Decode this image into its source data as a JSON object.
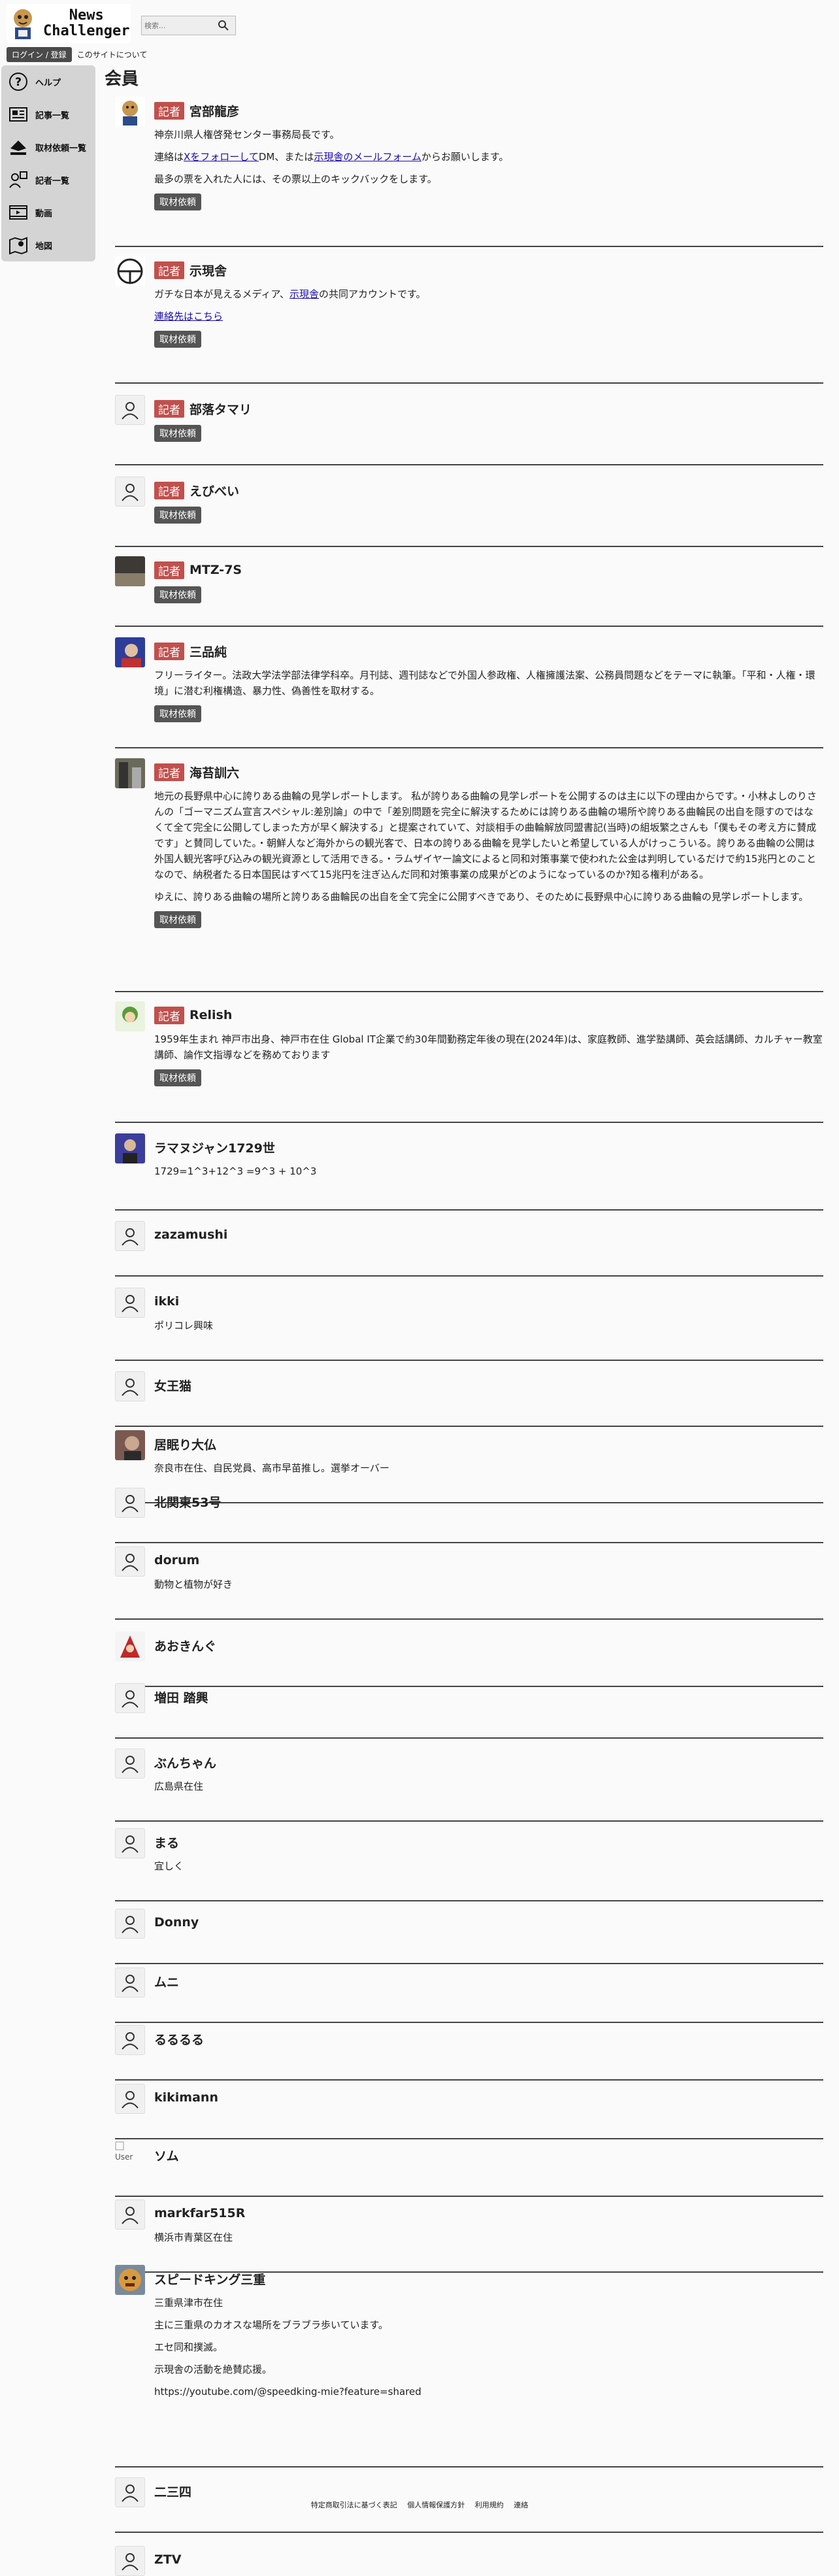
{
  "header": {
    "logo_line1": "News",
    "logo_line2": "Challenger",
    "search_placeholder": "検索...",
    "login_label": "ログイン / 登録",
    "about_label": "このサイトについて"
  },
  "sidebar": {
    "items": [
      {
        "label": "ヘルプ",
        "icon": "help-icon"
      },
      {
        "label": "記事一覧",
        "icon": "articles-icon"
      },
      {
        "label": "取材依頼一覧",
        "icon": "interview-requests-icon"
      },
      {
        "label": "記者一覧",
        "icon": "reporters-icon"
      },
      {
        "label": "動画",
        "icon": "video-icon"
      },
      {
        "label": "地図",
        "icon": "map-icon"
      }
    ]
  },
  "page_title": "会員",
  "badge_label": "記者",
  "request_label": "取材依頼",
  "members": [
    {
      "name": "宮部龍彦",
      "reporter": true,
      "lines": [
        "神奈川県人権啓発センター事務局長です。",
        "連絡は|Xをフォローして|DM、または|示現舎のメールフォーム|からお願いします。",
        "最多の票を入れた人には、その票以上のキックバックをします。"
      ]
    },
    {
      "name": "示現舎",
      "reporter": true,
      "lines": [
        "ガチな日本が見えるメディア、|示現舎|の共同アカウントです。",
        "|連絡先はこちら|"
      ]
    },
    {
      "name": "部落タマリ",
      "reporter": true,
      "lines": []
    },
    {
      "name": "えびべい",
      "reporter": true,
      "lines": []
    },
    {
      "name": "MTZ-7S",
      "reporter": true,
      "lines": []
    },
    {
      "name": "三品純",
      "reporter": true,
      "lines": [
        "フリーライター。法政大学法学部法律学科卒。月刊誌、週刊誌などで外国人参政権、人権擁護法案、公務員問題などをテーマに執筆。「平和・人権・環境」に潜む利権構造、暴力性、偽善性を取材する。"
      ]
    },
    {
      "name": "海苔訓六",
      "reporter": true,
      "lines": [
        "地元の長野県中心に誇りある曲輪の見学レポートします。 私が誇りある曲輪の見学レポートを公開するのは主に以下の理由からです。・小林よしのりさんの「ゴーマニズム宣言スペシャル:差別論」の中で「差別問題を完全に解決するためには誇りある曲輪の場所や誇りある曲輪民の出自を隠すのではなくて全て完全に公開してしまった方が早く解決する」と提案されていて、対談相手の曲輪解放同盟書記(当時)の組坂繁之さんも「僕もその考え方に賛成です」と賛同していた。・朝鮮人など海外からの観光客で、日本の誇りある曲輪を見学したいと希望している人がけっこういる。誇りある曲輪の公開は外国人観光客呼び込みの観光資源として活用できる。・ラムザイヤー論文によると同和対策事業で使われた公金は判明しているだけで約15兆円とのことなので、納税者たる日本国民はすべて15兆円を注ぎ込んだ同和対策事業の成果がどのようになっているのか?知る権利がある。",
        "ゆえに、誇りある曲輪の場所と誇りある曲輪民の出自を全て完全に公開すべきであり、そのために長野県中心に誇りある曲輪の見学レポートします。"
      ]
    },
    {
      "name": "Relish",
      "reporter": true,
      "lines": [
        "1959年生まれ 神戸市出身、神戸市在住 Global IT企業で約30年間勤務定年後の現在(2024年)は、家庭教師、進学塾講師、英会話講師、カルチャー教室講師、論作文指導などを務めております"
      ]
    },
    {
      "name": "ラマヌジャン1729世",
      "reporter": false,
      "lines": [
        "1729=1^3+12^3 =9^3 + 10^3"
      ]
    },
    {
      "name": "zazamushi",
      "reporter": false,
      "lines": []
    },
    {
      "name": "ikki",
      "reporter": false,
      "lines": [
        "ポリコレ興味"
      ]
    },
    {
      "name": "女王猫",
      "reporter": false,
      "lines": []
    },
    {
      "name": "居眠り大仏",
      "reporter": false,
      "lines": [
        "奈良市在住、自民党員、高市早苗推し。選挙オーバー"
      ]
    },
    {
      "name": "北関東53号",
      "reporter": false,
      "lines": []
    },
    {
      "name": "dorum",
      "reporter": false,
      "lines": [
        "動物と植物が好き"
      ]
    },
    {
      "name": "あおきんぐ",
      "reporter": false,
      "lines": []
    },
    {
      "name": "増田 踏興",
      "reporter": false,
      "lines": []
    },
    {
      "name": "ぶんちゃん",
      "reporter": false,
      "lines": [
        "広島県在住"
      ]
    },
    {
      "name": "まる",
      "reporter": false,
      "lines": [
        "宜しく"
      ]
    },
    {
      "name": "Donny",
      "reporter": false,
      "lines": []
    },
    {
      "name": "ムニ",
      "reporter": false,
      "lines": []
    },
    {
      "name": "るるるる",
      "reporter": false,
      "lines": []
    },
    {
      "name": "kikimann",
      "reporter": false,
      "lines": []
    },
    {
      "name": "ソム",
      "reporter": false,
      "lines": []
    },
    {
      "name": "markfar515R",
      "reporter": false,
      "lines": [
        "横浜市青葉区在住"
      ]
    },
    {
      "name": "スピードキング三重",
      "reporter": false,
      "lines": [
        "三重県津市在住",
        "主に三重県のカオスな場所をブラブラ歩いています。",
        "エセ同和撲滅。",
        "示現舎の活動を絶賛応援。",
        "https://youtube.com/@speedking-mie?feature=shared"
      ]
    },
    {
      "name": "二三四",
      "reporter": false,
      "lines": []
    },
    {
      "name": "ZTV",
      "reporter": false,
      "lines": []
    }
  ],
  "avatar_alt": "User",
  "footer": {
    "links": [
      "特定商取引法に基づく表記",
      "個人情報保護方針",
      "利用規約",
      "連絡"
    ]
  }
}
